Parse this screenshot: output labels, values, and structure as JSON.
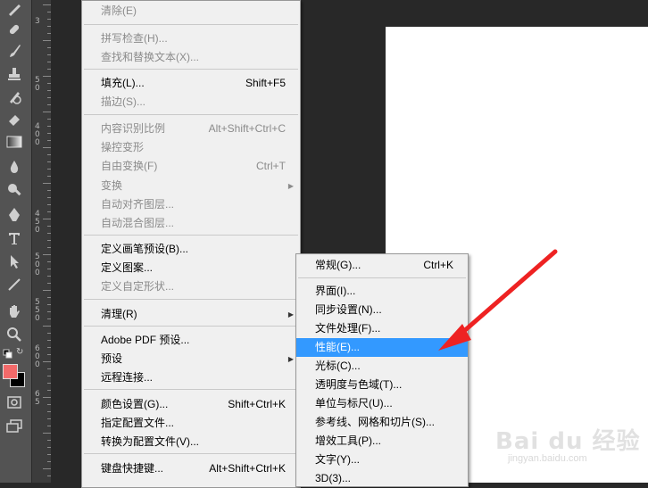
{
  "main_menu": {
    "items": [
      {
        "label": "清除(E)",
        "shortcut": "",
        "disabled": true,
        "submenu": false
      },
      {
        "label": "拼写检查(H)...",
        "shortcut": "",
        "disabled": true,
        "submenu": false
      },
      {
        "label": "查找和替换文本(X)...",
        "shortcut": "",
        "disabled": true,
        "submenu": false
      },
      {
        "label": "填充(L)...",
        "shortcut": "Shift+F5",
        "disabled": false,
        "submenu": false
      },
      {
        "label": "描边(S)...",
        "shortcut": "",
        "disabled": true,
        "submenu": false
      },
      {
        "label": "内容识别比例",
        "shortcut": "Alt+Shift+Ctrl+C",
        "disabled": true,
        "submenu": false
      },
      {
        "label": "操控变形",
        "shortcut": "",
        "disabled": true,
        "submenu": false
      },
      {
        "label": "自由变换(F)",
        "shortcut": "Ctrl+T",
        "disabled": true,
        "submenu": false
      },
      {
        "label": "变换",
        "shortcut": "",
        "disabled": true,
        "submenu": true
      },
      {
        "label": "自动对齐图层...",
        "shortcut": "",
        "disabled": true,
        "submenu": false
      },
      {
        "label": "自动混合图层...",
        "shortcut": "",
        "disabled": true,
        "submenu": false
      },
      {
        "label": "定义画笔预设(B)...",
        "shortcut": "",
        "disabled": false,
        "submenu": false
      },
      {
        "label": "定义图案...",
        "shortcut": "",
        "disabled": false,
        "submenu": false
      },
      {
        "label": "定义自定形状...",
        "shortcut": "",
        "disabled": true,
        "submenu": false
      },
      {
        "label": "清理(R)",
        "shortcut": "",
        "disabled": false,
        "submenu": true
      },
      {
        "label": "Adobe PDF 预设...",
        "shortcut": "",
        "disabled": false,
        "submenu": false
      },
      {
        "label": "预设",
        "shortcut": "",
        "disabled": false,
        "submenu": true
      },
      {
        "label": "远程连接...",
        "shortcut": "",
        "disabled": false,
        "submenu": false
      },
      {
        "label": "颜色设置(G)...",
        "shortcut": "Shift+Ctrl+K",
        "disabled": false,
        "submenu": false
      },
      {
        "label": "指定配置文件...",
        "shortcut": "",
        "disabled": false,
        "submenu": false
      },
      {
        "label": "转换为配置文件(V)...",
        "shortcut": "",
        "disabled": false,
        "submenu": false
      },
      {
        "label": "键盘快捷键...",
        "shortcut": "Alt+Shift+Ctrl+K",
        "disabled": false,
        "submenu": false
      }
    ]
  },
  "sub_menu": {
    "items": [
      {
        "label": "常规(G)...",
        "shortcut": "Ctrl+K",
        "highlighted": false
      },
      {
        "label": "界面(I)...",
        "shortcut": "",
        "highlighted": false
      },
      {
        "label": "同步设置(N)...",
        "shortcut": "",
        "highlighted": false
      },
      {
        "label": "文件处理(F)...",
        "shortcut": "",
        "highlighted": false
      },
      {
        "label": "性能(E)...",
        "shortcut": "",
        "highlighted": true
      },
      {
        "label": "光标(C)...",
        "shortcut": "",
        "highlighted": false
      },
      {
        "label": "透明度与色域(T)...",
        "shortcut": "",
        "highlighted": false
      },
      {
        "label": "单位与标尺(U)...",
        "shortcut": "",
        "highlighted": false
      },
      {
        "label": "参考线、网格和切片(S)...",
        "shortcut": "",
        "highlighted": false
      },
      {
        "label": "增效工具(P)...",
        "shortcut": "",
        "highlighted": false
      },
      {
        "label": "文字(Y)...",
        "shortcut": "",
        "highlighted": false
      },
      {
        "label": "3D(3)...",
        "shortcut": "",
        "highlighted": false
      }
    ]
  },
  "ruler": {
    "labels": [
      "3",
      "5",
      "0",
      "4",
      "0",
      "0",
      "4",
      "5",
      "0",
      "5",
      "0",
      "0",
      "5",
      "5",
      "0",
      "6",
      "0",
      "0",
      "6",
      "5"
    ]
  },
  "tools": [
    "pencil-icon",
    "healing-brush-icon",
    "brush-icon",
    "clone-stamp-icon",
    "history-brush-icon",
    "eraser-icon",
    "gradient-icon",
    "blur-icon",
    "dodge-icon",
    "pen-icon",
    "type-icon",
    "path-selection-icon",
    "line-icon",
    "hand-icon",
    "zoom-icon"
  ],
  "colors": {
    "foreground": "#f36a6a",
    "background": "#000000",
    "highlight": "#3399ff",
    "annotation_arrow": "#ee2222"
  },
  "watermark": {
    "logo": "Bai du 经验",
    "url": "jingyan.baidu.com"
  }
}
